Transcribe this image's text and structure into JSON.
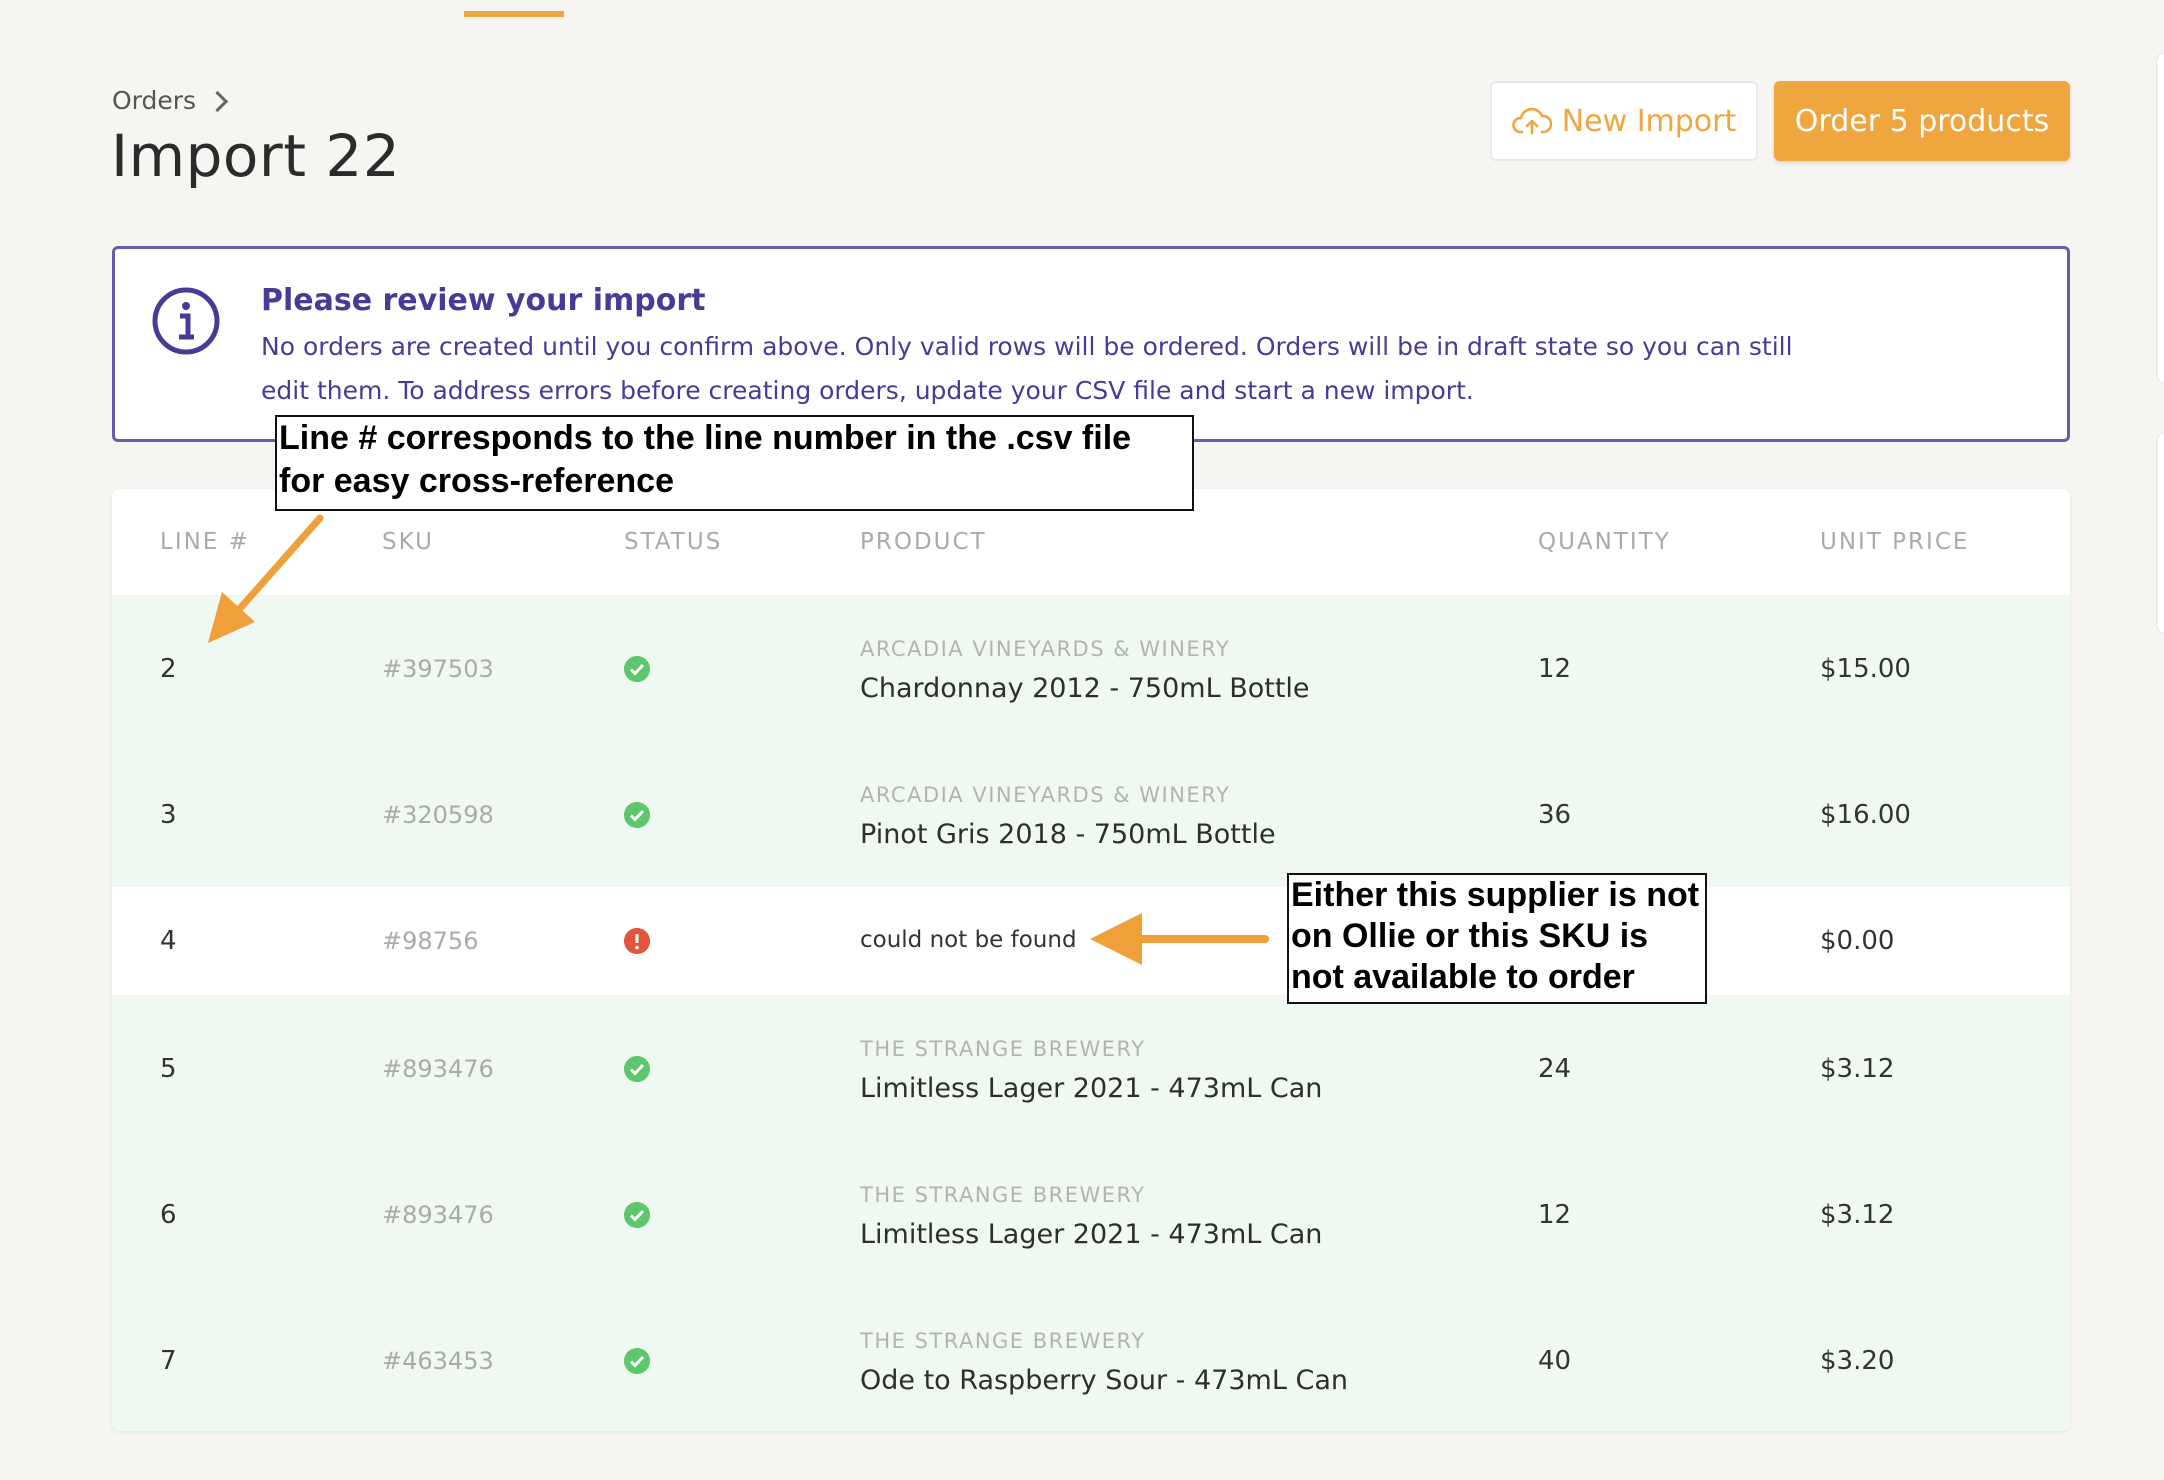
{
  "breadcrumb": {
    "parent": "Orders"
  },
  "page": {
    "title": "Import 22"
  },
  "actions": {
    "new_import": "New Import",
    "order": "Order 5 products"
  },
  "notice": {
    "title": "Please review your import",
    "body": "No orders are created until you confirm above. Only valid rows will be ordered. Orders will be in draft state so you can still edit them. To address errors before creating orders, update your CSV file and start a new import."
  },
  "table": {
    "columns": {
      "line": "LINE #",
      "sku": "SKU",
      "status": "STATUS",
      "product": "PRODUCT",
      "quantity": "QUANTITY",
      "unit_price": "UNIT PRICE"
    },
    "rows": [
      {
        "line": "2",
        "sku": "#397503",
        "status": "ok",
        "supplier": "ARCADIA VINEYARDS & WINERY",
        "product": "Chardonnay 2012 - 750mL Bottle",
        "quantity": "12",
        "price": "$15.00"
      },
      {
        "line": "3",
        "sku": "#320598",
        "status": "ok",
        "supplier": "ARCADIA VINEYARDS & WINERY",
        "product": "Pinot Gris 2018 - 750mL Bottle",
        "quantity": "36",
        "price": "$16.00"
      },
      {
        "line": "4",
        "sku": "#98756",
        "status": "error",
        "error": "could not be found",
        "price": "$0.00"
      },
      {
        "line": "5",
        "sku": "#893476",
        "status": "ok",
        "supplier": "THE STRANGE BREWERY",
        "product": "Limitless Lager 2021 - 473mL Can",
        "quantity": "24",
        "price": "$3.12"
      },
      {
        "line": "6",
        "sku": "#893476",
        "status": "ok",
        "supplier": "THE STRANGE BREWERY",
        "product": "Limitless Lager 2021 - 473mL Can",
        "quantity": "12",
        "price": "$3.12"
      },
      {
        "line": "7",
        "sku": "#463453",
        "status": "ok",
        "supplier": "THE STRANGE BREWERY",
        "product": "Ode to Raspberry Sour - 473mL Can",
        "quantity": "40",
        "price": "$3.20"
      }
    ]
  },
  "annotations": {
    "line_note": {
      "line1": "Line # corresponds to the line number in the .csv file",
      "line2": "for easy cross-reference"
    },
    "sku_note": {
      "line1": "Either this supplier is not",
      "line2": "on Ollie or this SKU is",
      "line3": "not available to order"
    }
  },
  "colors": {
    "accent": "#f0a63e",
    "notice": "#4a3a96",
    "ok": "#5cc86b",
    "error": "#e2543b",
    "ok_row": "#eff9f1"
  },
  "icons": {
    "upload": "cloud-upload-icon",
    "info": "info-icon",
    "chevron": "chevron-right-icon",
    "ok": "check-circle-icon",
    "error": "alert-circle-icon"
  }
}
